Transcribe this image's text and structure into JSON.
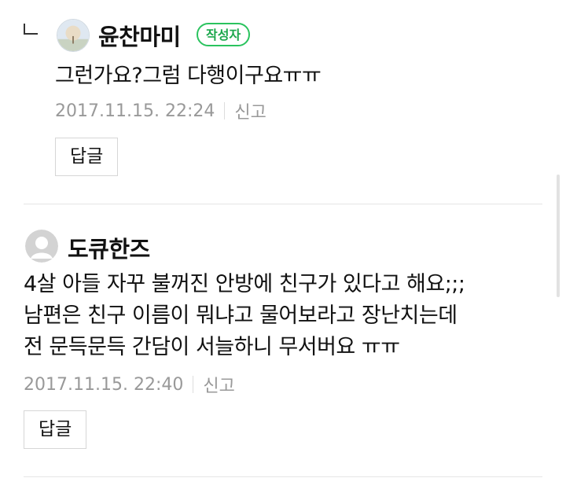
{
  "comments": [
    {
      "is_reply": true,
      "nickname": "윤찬마미",
      "badge": "작성자",
      "text_lines": [
        "그런가요?그럼 다행이구요ㅠㅠ"
      ],
      "date": "2017.11.15. 22:24",
      "report": "신고",
      "reply_label": "답글"
    },
    {
      "is_reply": false,
      "nickname": "도큐한즈",
      "text_lines": [
        "4살 아들 자꾸 불꺼진 안방에 친구가 있다고 해요;;;",
        "남편은 친구 이름이 뭐냐고 물어보라고 장난치는데",
        "전 문득문득 간담이 서늘하니 무서버요 ㅠㅠ"
      ],
      "date": "2017.11.15. 22:40",
      "report": "신고",
      "reply_label": "답글"
    }
  ],
  "colors": {
    "badge_green": "#2ac35e",
    "meta_gray": "#999999",
    "divider": "#e5e5e5"
  }
}
